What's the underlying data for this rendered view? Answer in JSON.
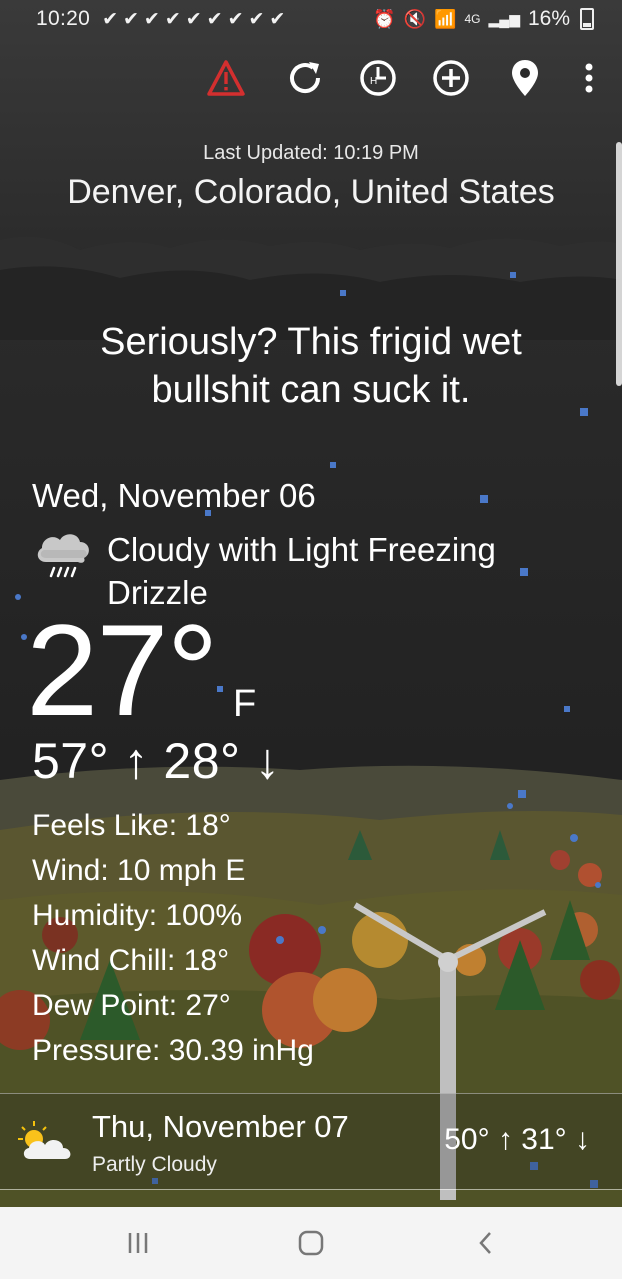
{
  "status_bar": {
    "time": "10:20",
    "notification_checks": "✔✔✔✔✔✔✔✔✔",
    "network": "4G",
    "battery": "16%"
  },
  "toolbar": {
    "icons": [
      "warning-icon",
      "refresh-icon",
      "hourly-icon",
      "add-icon",
      "location-pin-icon",
      "more-vert-icon"
    ],
    "warning_color": "#d32f2f"
  },
  "header": {
    "last_updated": "Last Updated: 10:19 PM",
    "location": "Denver, Colorado, United States"
  },
  "headline": "Seriously? This frigid wet bullshit can suck it.",
  "current": {
    "date": "Wed, November 06",
    "condition": "Cloudy with Light Freezing Drizzle",
    "icon": "cloud-freezing-drizzle-icon",
    "temperature": "27°",
    "unit": "F",
    "high_low": "57° ↑ 28° ↓",
    "details": {
      "feels_like": "Feels Like: 18°",
      "wind": "Wind: 10 mph E",
      "humidity": "Humidity: 100%",
      "wind_chill": "Wind Chill: 18°",
      "dew_point": "Dew Point: 27°",
      "pressure": "Pressure: 30.39 inHg"
    }
  },
  "forecast": [
    {
      "date": "Thu, November 07",
      "condition": "Partly Cloudy",
      "temps": "50° ↑ 31° ↓",
      "icon": "partly-cloudy-icon"
    }
  ],
  "nav_bar": {
    "buttons": [
      "recent-apps-icon",
      "home-icon",
      "back-icon"
    ]
  }
}
